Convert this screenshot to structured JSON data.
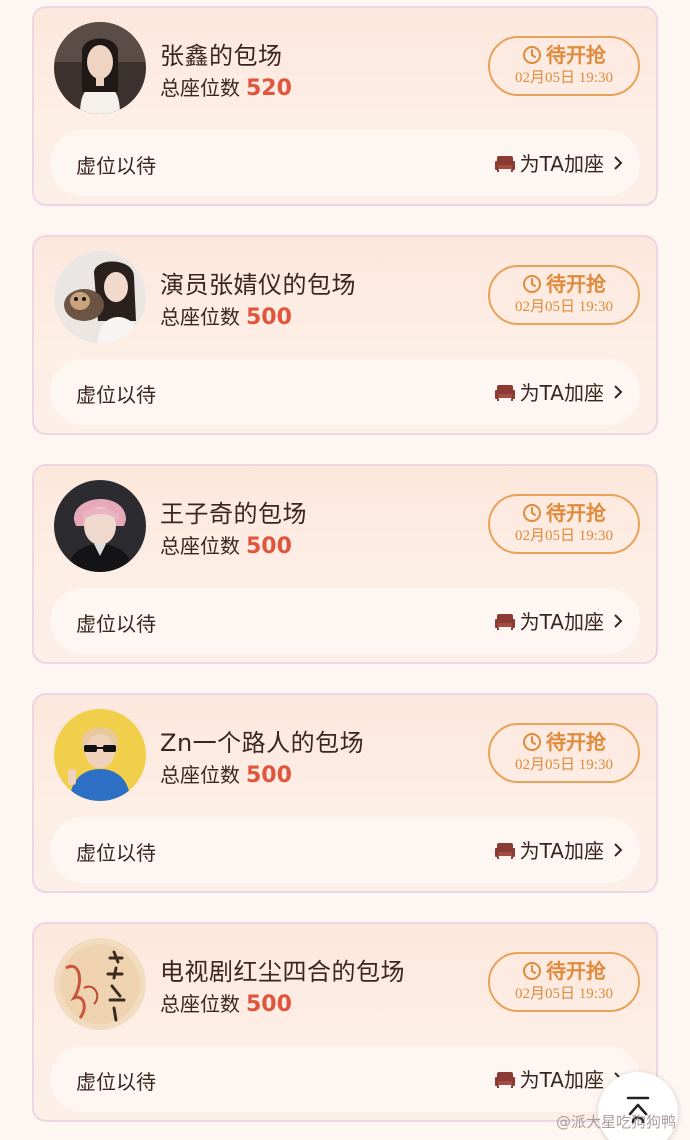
{
  "cards": [
    {
      "title": "张鑫的包场",
      "seats_label": "总座位数",
      "seats": "520",
      "status": "待开抢",
      "time": "02月05日 19:30",
      "vacant": "虚位以待",
      "add": "为TA加座"
    },
    {
      "title": "演员张婧仪的包场",
      "seats_label": "总座位数",
      "seats": "500",
      "status": "待开抢",
      "time": "02月05日 19:30",
      "vacant": "虚位以待",
      "add": "为TA加座"
    },
    {
      "title": "王子奇的包场",
      "seats_label": "总座位数",
      "seats": "500",
      "status": "待开抢",
      "time": "02月05日 19:30",
      "vacant": "虚位以待",
      "add": "为TA加座"
    },
    {
      "title": "Zn一个路人的包场",
      "seats_label": "总座位数",
      "seats": "500",
      "status": "待开抢",
      "time": "02月05日 19:30",
      "vacant": "虚位以待",
      "add": "为TA加座"
    },
    {
      "title": "电视剧红尘四合的包场",
      "seats_label": "总座位数",
      "seats": "500",
      "status": "待开抢",
      "time": "02月05日 19:30",
      "vacant": "虚位以待",
      "add": "为TA加座"
    }
  ],
  "icons": {
    "status": "clock-icon",
    "add": "sofa-icon",
    "chevron": "chevron-right-icon",
    "scroll": "scroll-to-top-icon"
  },
  "colors": {
    "accent": "#e08a3c",
    "seat_number": "#e0553c",
    "text": "#3a2620"
  },
  "watermark": "@派大星吃狗狗鸭"
}
